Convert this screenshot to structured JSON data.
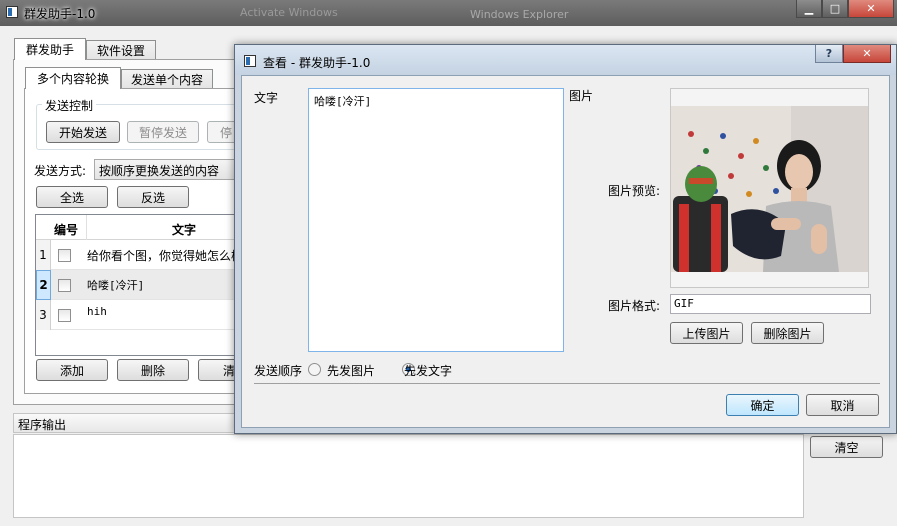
{
  "main_window": {
    "title": "群发助手-1.0",
    "bg_titles": [
      "Activate Windows",
      "Windows Explorer"
    ],
    "tabs": [
      "群发助手",
      "软件设置"
    ],
    "subtabs": [
      "多个内容轮换",
      "发送单个内容"
    ],
    "send_control": {
      "legend": "发送控制",
      "start_label": "开始发送",
      "pause_label": "暂停发送",
      "stop_label": "停"
    },
    "send_mode": {
      "label": "发送方式:",
      "value": "按顺序更换发送的内容"
    },
    "select_all_label": "全选",
    "invert_label": "反选",
    "table": {
      "headers": [
        "编号",
        "文字"
      ],
      "rows": [
        {
          "num": "1",
          "text": "给你看个图，你觉得她怎么样"
        },
        {
          "num": "2",
          "text": "哈喽[冷汗]"
        },
        {
          "num": "3",
          "text": "hih"
        }
      ]
    },
    "add_label": "添加",
    "delete_label": "删除",
    "clear_list_label": "清",
    "output": {
      "label": "程序输出",
      "clear_label": "清空"
    }
  },
  "dialog": {
    "title": "查看 - 群发助手-1.0",
    "text_label": "文字",
    "text_value": "哈喽[冷汗]",
    "image_label": "图片",
    "preview_label": "图片预览:",
    "format_label": "图片格式:",
    "format_value": "GIF",
    "upload_label": "上传图片",
    "delete_image_label": "删除图片",
    "order_label": "发送顺序",
    "order_options": [
      {
        "label": "先发图片",
        "checked": false
      },
      {
        "label": "先发文字",
        "checked": true
      }
    ],
    "ok_label": "确定",
    "cancel_label": "取消"
  },
  "colors": {
    "close_red": "#c7463a",
    "dialog_frame": "#c9d4e0",
    "highlight_blue": "#cde8ff",
    "selected_row": "#e8e8e8"
  }
}
